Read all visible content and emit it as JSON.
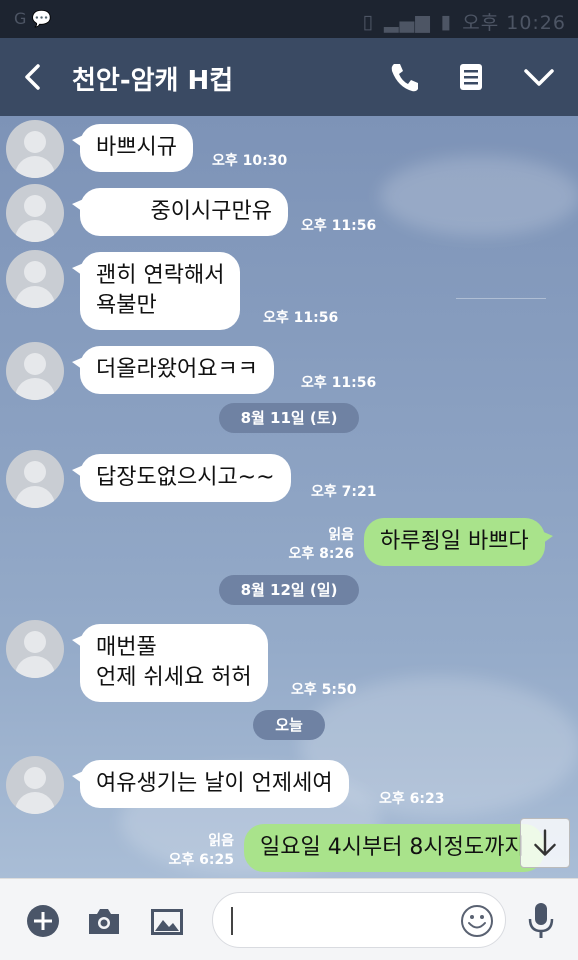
{
  "status_bar": {
    "left_icons": "G 💬",
    "time": "오후 10:26"
  },
  "header": {
    "title": "천안-암캐 H컵",
    "back_icon": "chevron-left-icon",
    "call_icon": "phone-icon",
    "menu_icon": "list-icon",
    "expand_icon": "chevron-down-icon"
  },
  "messages": [
    {
      "from": "them",
      "text": "바쁘시규",
      "time": "오후 10:30"
    },
    {
      "from": "them",
      "text": "중이시구만유",
      "time": "오후 11:56"
    },
    {
      "from": "them",
      "text": "괜히 연락해서\n욕불만",
      "time": "오후 11:56"
    },
    {
      "from": "them",
      "text": "더올라왔어요ㅋㅋ",
      "time": "오후 11:56"
    },
    {
      "type": "date",
      "text": "8월 11일 (토)"
    },
    {
      "from": "them",
      "text": "답장도없으시고~~",
      "time": "오후 7:21"
    },
    {
      "from": "me",
      "text": "하루죙일 바쁘다",
      "read": "읽음",
      "time": "오후 8:26"
    },
    {
      "type": "date",
      "text": "8월 12일 (일)"
    },
    {
      "from": "them",
      "text": "매번풀\n언제 쉬세요 허허",
      "time": "오후 5:50"
    },
    {
      "type": "date",
      "text": "오늘"
    },
    {
      "from": "them",
      "text": "여유생기는 날이 언제세여",
      "time": "오후 6:23"
    },
    {
      "from": "me",
      "text": "일요일 4시부터 8시정도까지",
      "read": "읽음",
      "time": "오후 6:25"
    }
  ],
  "input_bar": {
    "placeholder": "",
    "add_icon": "plus-circle-icon",
    "camera_icon": "camera-icon",
    "gallery_icon": "image-icon",
    "emoji_icon": "smiley-icon",
    "mic_icon": "microphone-icon"
  },
  "colors": {
    "header": "#3a4a63",
    "chat_bg": "#8aa0c1",
    "my_bubble": "#a9e38b",
    "their_bubble": "#ffffff",
    "date_chip": "#6f82a3"
  }
}
